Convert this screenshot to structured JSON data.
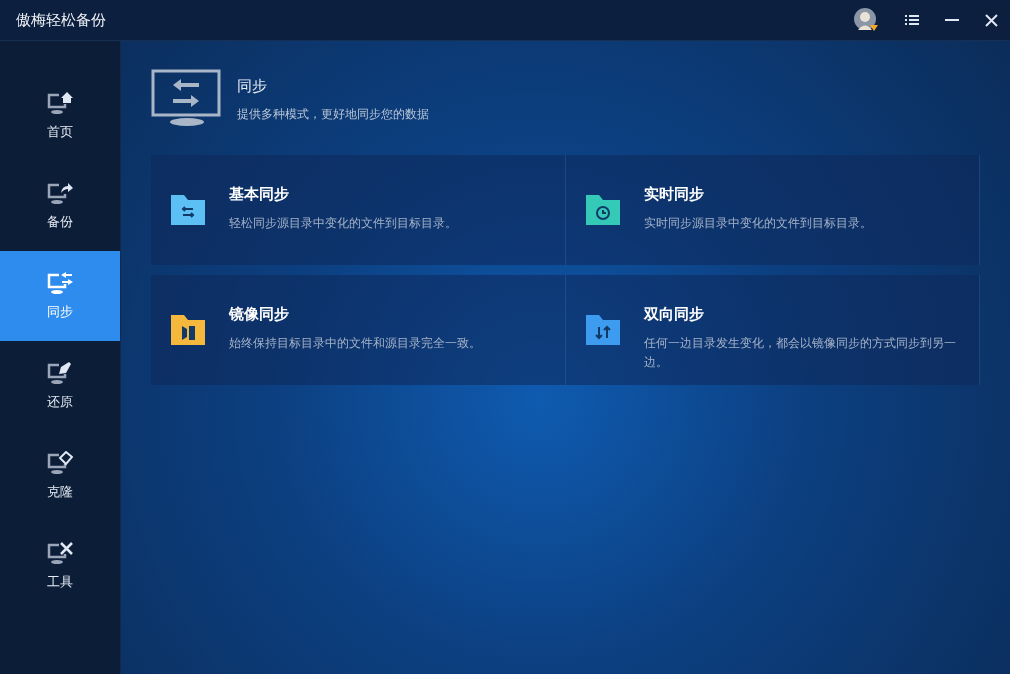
{
  "window": {
    "title": "傲梅轻松备份"
  },
  "sidebar": {
    "items": [
      {
        "label": "首页",
        "selected": false
      },
      {
        "label": "备份",
        "selected": false
      },
      {
        "label": "同步",
        "selected": true
      },
      {
        "label": "还原",
        "selected": false
      },
      {
        "label": "克隆",
        "selected": false
      },
      {
        "label": "工具",
        "selected": false
      }
    ]
  },
  "header": {
    "title": "同步",
    "subtitle": "提供多种模式，更好地同步您的数据"
  },
  "cards": [
    {
      "title": "基本同步",
      "description": "轻松同步源目录中变化的文件到目标目录。",
      "color": "#5cc0f5"
    },
    {
      "title": "实时同步",
      "description": "实时同步源目录中变化的文件到目标目录。",
      "color": "#35c9b8"
    },
    {
      "title": "镜像同步",
      "description": "始终保持目标目录中的文件和源目录完全一致。",
      "color": "#f5b83c"
    },
    {
      "title": "双向同步",
      "description": "任何一边目录发生变化，都会以镜像同步的方式同步到另一边。",
      "color": "#3d9cf0"
    }
  ]
}
